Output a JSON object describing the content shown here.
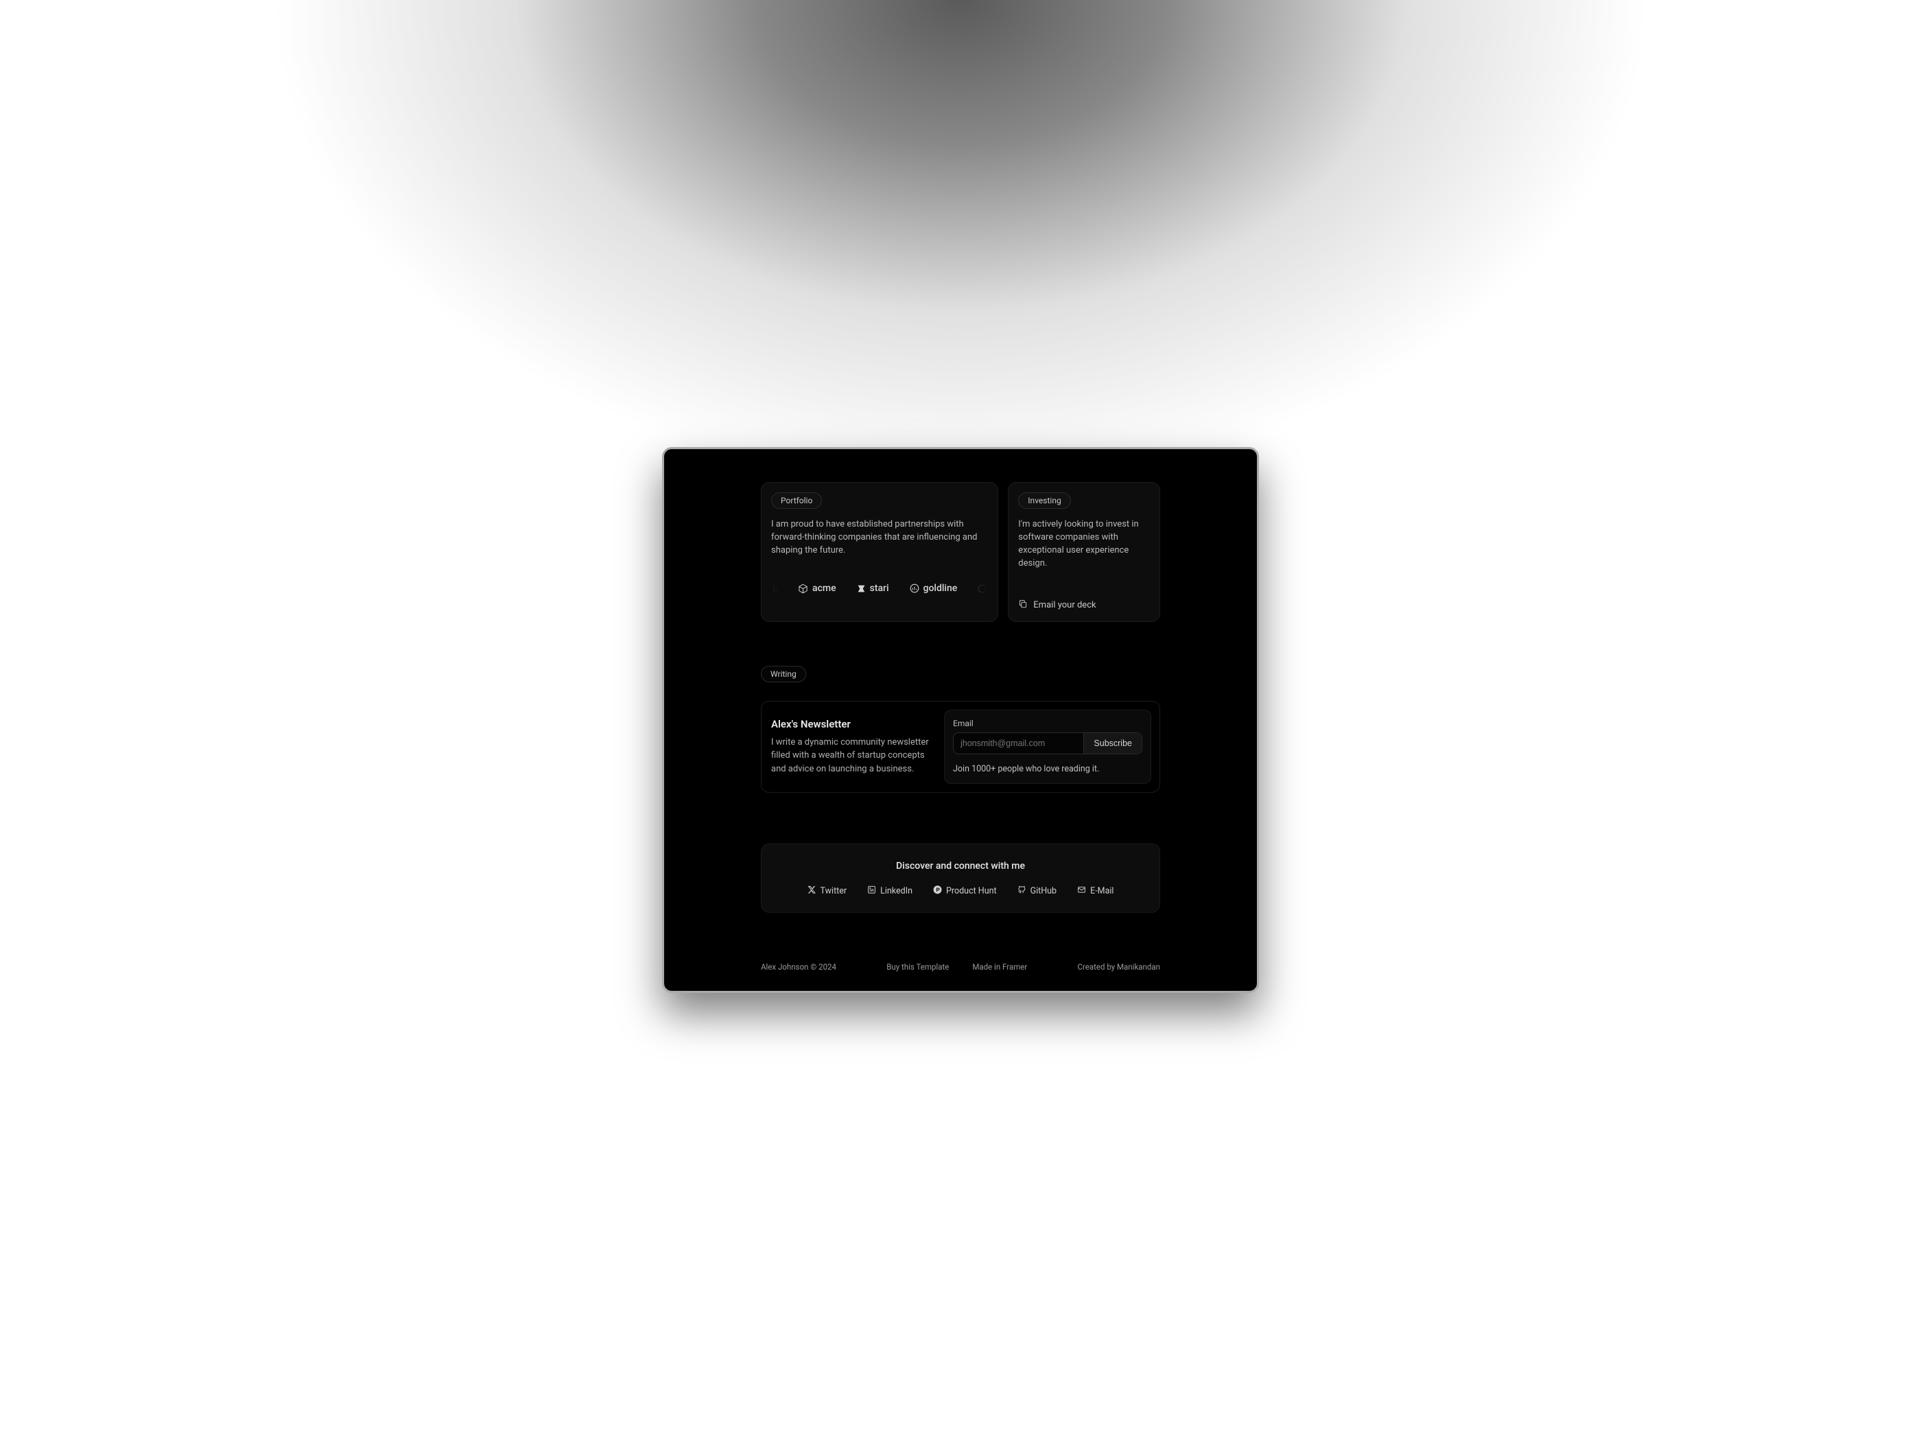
{
  "portfolio": {
    "pill": "Portfolio",
    "text": "I am proud to have established partnerships with forward-thinking companies that are influencing and shaping the future.",
    "logos": [
      "acme",
      "stari",
      "goldline"
    ]
  },
  "investing": {
    "pill": "Investing",
    "text": "I'm actively looking to invest in software companies with exceptional user experience design.",
    "emailLink": "Email your deck"
  },
  "writing": {
    "pill": "Writing",
    "title": "Alex's Newsletter",
    "desc": "I write a dynamic community newsletter filled with a wealth of startup concepts and advice on launching a business.",
    "fieldLabel": "Email",
    "placeholder": "jhonsmith@gmail.com",
    "subscribe": "Subscribe",
    "joinText": "Join 1000+ people who love reading it."
  },
  "connect": {
    "title": "Discover and connect with me",
    "links": {
      "twitter": "Twitter",
      "linkedin": "LinkedIn",
      "producthunt": "Product Hunt",
      "github": "GitHub",
      "email": "E-Mail"
    }
  },
  "footer": {
    "left": "Alex Johnson © 2024",
    "buy": "Buy this Template",
    "made": "Made in Framer",
    "right": "Created by Manikandan"
  }
}
